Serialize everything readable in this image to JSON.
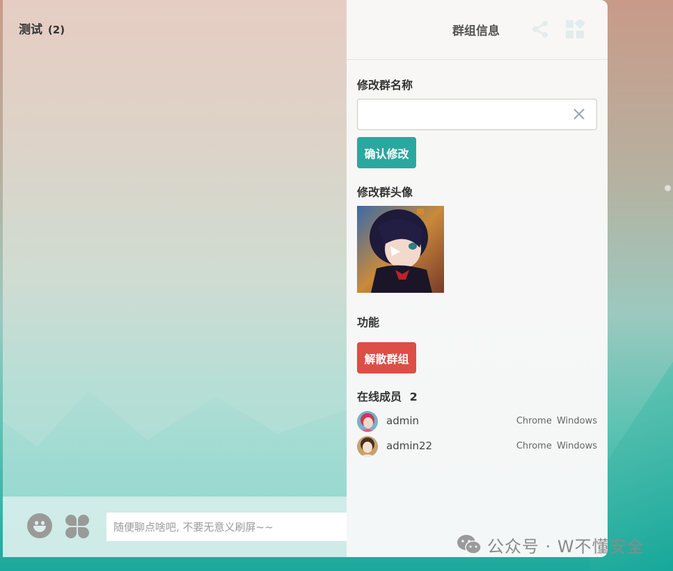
{
  "chat": {
    "title": "测试",
    "member_count": "(2)"
  },
  "composer": {
    "placeholder": "随便聊点啥吧, 不要无意义刷屏~~"
  },
  "panel": {
    "title": "群组信息",
    "rename_label": "修改群名称",
    "rename_value": "",
    "confirm_label": "确认修改",
    "avatar_label": "修改群头像",
    "functions_label": "功能",
    "dissolve_label": "解散群组",
    "online_label": "在线成员",
    "online_count": "2",
    "members": [
      {
        "name": "admin",
        "browser": "Chrome",
        "os": "Windows"
      },
      {
        "name": "admin22",
        "browser": "Chrome",
        "os": "Windows"
      }
    ]
  },
  "icons": {
    "emoji": "smiley-icon",
    "apps": "clover-icon",
    "share": "share-icon",
    "grid": "grid-icon",
    "clear": "close-icon",
    "mention": "at-icon",
    "send": "send-icon"
  },
  "colors": {
    "confirm_button": "#2aa89f",
    "dissolve_button": "#dc4e46"
  },
  "watermark": {
    "text": "公众号 · W不懂安全"
  }
}
